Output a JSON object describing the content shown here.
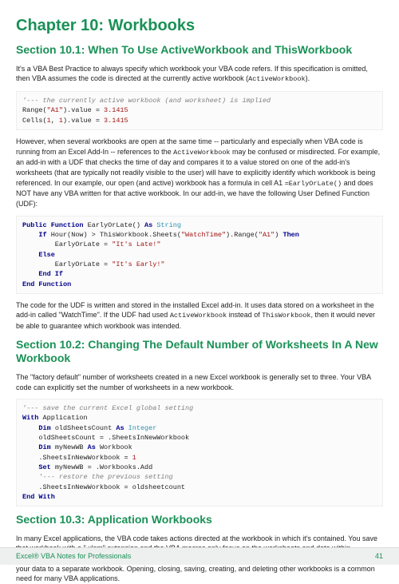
{
  "chapter": {
    "title": "Chapter 10: Workbooks"
  },
  "section1": {
    "title": "Section 10.1: When To Use ActiveWorkbook and ThisWorkbook",
    "p1a": "It's a VBA Best Practice to always specify which workbook your VBA code refers. If this specification is omitted, then VBA assumes the code is directed at the currently active workbook (",
    "p1b": "ActiveWorkbook",
    "p1c": ").",
    "code1": {
      "l1a": "'--- the currently active workbook (and worksheet) is implied",
      "l2a": "Range(",
      "l2b": "\"A1\"",
      "l2c": ").value = ",
      "l2d": "3.1415",
      "l3a": "Cells(",
      "l3b": "1",
      "l3c": ", ",
      "l3d": "1",
      "l3e": ").value = ",
      "l3f": "3.1415"
    },
    "p2a": "However, when several workbooks are open at the same time -- particularly and especially when VBA code is running from an Excel Add-In -- references to the ",
    "p2b": "ActiveWorkbook",
    "p2c": " may be confused or misdirected. For example, an add-in with a UDF that checks the time of day and compares it to a value stored on one of the add-in's worksheets (that are typically not readily visible to the user) will have to explicitly identify which workbook is being referenced. In our example, our open (and active) workbook has a formula in cell A1 ",
    "p2d": "=EarlyOrLate()",
    "p2e": " and does NOT have any VBA written for that active workbook. In our add-in, we have the following User Defined Function (UDF):",
    "code2": {
      "l1a": "Public Function",
      "l1b": " EarlyOrLate() ",
      "l1c": "As",
      "l1d": " String",
      "l2a": "    If",
      "l2b": " Hour(Now) > ThisWorkbook.Sheets(",
      "l2c": "\"WatchTime\"",
      "l2d": ").Range(",
      "l2e": "\"A1\"",
      "l2f": ") ",
      "l2g": "Then",
      "l3a": "        EarlyOrLate = ",
      "l3b": "\"It's Late!\"",
      "l4a": "    Else",
      "l5a": "        EarlyOrLate = ",
      "l5b": "\"It's Early!\"",
      "l6a": "    End If",
      "l7a": "End Function"
    },
    "p3a": "The code for the UDF is written and stored in the installed Excel add-in. It uses data stored on a worksheet in the add-in called \"WatchTime\". If the UDF had used ",
    "p3b": "ActiveWorkbook",
    "p3c": " instead of ",
    "p3d": "ThisWorkbook",
    "p3e": ", then it would never be able to guarantee which workbook was intended."
  },
  "section2": {
    "title": "Section 10.2: Changing The Default Number of Worksheets In A New Workbook",
    "p1": "The \"factory default\" number of worksheets created in a new Excel workbook is generally set to three. Your VBA code can explicitly set the number of worksheets in a new workbook.",
    "code": {
      "l1a": "'--- save the current Excel global setting",
      "l2a": "With",
      "l2b": " Application",
      "l3a": "    Dim",
      "l3b": " oldSheetsCount ",
      "l3c": "As",
      "l3d": " Integer",
      "l4a": "    oldSheetsCount = .SheetsInNewWorkbook",
      "l5a": "    Dim",
      "l5b": " myNewWB ",
      "l5c": "As",
      "l5d": " Workbook",
      "l6a": "    .SheetsInNewWorkbook = ",
      "l6b": "1",
      "l7a": "    Set",
      "l7b": " myNewWB = .Workbooks.Add",
      "l8a": "    '--- restore the previous setting",
      "l9a": "    .SheetsInNewWorkbook = oldsheetcount",
      "l10a": "End With"
    }
  },
  "section3": {
    "title": "Section 10.3: Application Workbooks",
    "p1": "In many Excel applications, the VBA code takes actions directed at the workbook in which it's contained. You save that workbook with a \".xlsm\" extension and the VBA macros only focus on the worksheets and data within. However, there are often times when you need to combine or merge data from other workbooks, or write some of your data to a separate workbook. Opening, closing, saving, creating, and deleting other workbooks is a common need for many VBA applications."
  },
  "footer": {
    "left": "Excel® VBA Notes for Professionals",
    "right": "41"
  }
}
